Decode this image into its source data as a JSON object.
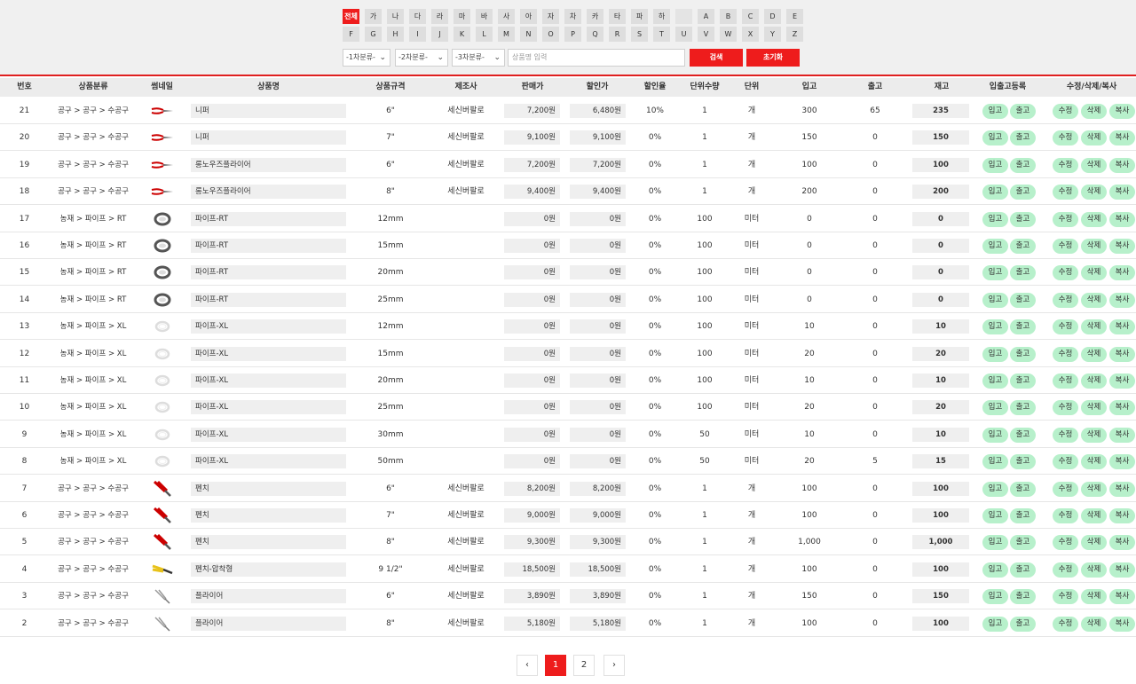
{
  "filter": {
    "letters_row1": [
      "전체",
      "가",
      "나",
      "다",
      "라",
      "마",
      "바",
      "사",
      "아",
      "자",
      "차",
      "카",
      "타",
      "파",
      "하",
      "",
      "A",
      "B",
      "C",
      "D",
      "E"
    ],
    "letters_row2": [
      "F",
      "G",
      "H",
      "I",
      "J",
      "K",
      "L",
      "M",
      "N",
      "O",
      "P",
      "Q",
      "R",
      "S",
      "T",
      "U",
      "V",
      "W",
      "X",
      "Y",
      "Z"
    ],
    "active_letter": "전체",
    "cat1": "-1차분류-",
    "cat2": "-2차분류-",
    "cat3": "-3차분류-",
    "search_placeholder": "상품명 입력",
    "search_label": "검색",
    "reset_label": "초기화"
  },
  "columns": [
    "번호",
    "상품분류",
    "썸네일",
    "상품명",
    "상품규격",
    "제조사",
    "판매가",
    "할인가",
    "할인율",
    "단위수량",
    "단위",
    "입고",
    "출고",
    "재고",
    "입출고등록",
    "수정/삭제/복사"
  ],
  "action_labels": {
    "in": "입고",
    "out": "출고",
    "edit": "수정",
    "delete": "삭제",
    "copy": "복사"
  },
  "accent_color": "#ee1c1c",
  "button_green": "#b7f0cb",
  "rows": [
    {
      "no": "21",
      "cat": "공구 > 공구 > 수공구",
      "thumb": "nipper-icon",
      "name": "니퍼",
      "spec": "6\"",
      "maker": "세신버팔로",
      "price": "7,200원",
      "sale": "6,480원",
      "rate": "10%",
      "unit_qty": "1",
      "unit": "개",
      "in_qty": "300",
      "out_qty": "65",
      "stock": "235"
    },
    {
      "no": "20",
      "cat": "공구 > 공구 > 수공구",
      "thumb": "nipper-icon",
      "name": "니퍼",
      "spec": "7\"",
      "maker": "세신버팔로",
      "price": "9,100원",
      "sale": "9,100원",
      "rate": "0%",
      "unit_qty": "1",
      "unit": "개",
      "in_qty": "150",
      "out_qty": "0",
      "stock": "150"
    },
    {
      "no": "19",
      "cat": "공구 > 공구 > 수공구",
      "thumb": "nipper-icon",
      "name": "롱노우즈플라이어",
      "spec": "6\"",
      "maker": "세신버팔로",
      "price": "7,200원",
      "sale": "7,200원",
      "rate": "0%",
      "unit_qty": "1",
      "unit": "개",
      "in_qty": "100",
      "out_qty": "0",
      "stock": "100"
    },
    {
      "no": "18",
      "cat": "공구 > 공구 > 수공구",
      "thumb": "nipper-icon",
      "name": "롱노우즈플라이어",
      "spec": "8\"",
      "maker": "세신버팔로",
      "price": "9,400원",
      "sale": "9,400원",
      "rate": "0%",
      "unit_qty": "1",
      "unit": "개",
      "in_qty": "200",
      "out_qty": "0",
      "stock": "200"
    },
    {
      "no": "17",
      "cat": "농재 > 파이프 > RT",
      "thumb": "pipe-rt-icon",
      "name": "파이프-RT",
      "spec": "12mm",
      "maker": "",
      "price": "0원",
      "sale": "0원",
      "rate": "0%",
      "unit_qty": "100",
      "unit": "미터",
      "in_qty": "0",
      "out_qty": "0",
      "stock": "0"
    },
    {
      "no": "16",
      "cat": "농재 > 파이프 > RT",
      "thumb": "pipe-rt-icon",
      "name": "파이프-RT",
      "spec": "15mm",
      "maker": "",
      "price": "0원",
      "sale": "0원",
      "rate": "0%",
      "unit_qty": "100",
      "unit": "미터",
      "in_qty": "0",
      "out_qty": "0",
      "stock": "0"
    },
    {
      "no": "15",
      "cat": "농재 > 파이프 > RT",
      "thumb": "pipe-rt-icon",
      "name": "파이프-RT",
      "spec": "20mm",
      "maker": "",
      "price": "0원",
      "sale": "0원",
      "rate": "0%",
      "unit_qty": "100",
      "unit": "미터",
      "in_qty": "0",
      "out_qty": "0",
      "stock": "0"
    },
    {
      "no": "14",
      "cat": "농재 > 파이프 > RT",
      "thumb": "pipe-rt-icon",
      "name": "파이프-RT",
      "spec": "25mm",
      "maker": "",
      "price": "0원",
      "sale": "0원",
      "rate": "0%",
      "unit_qty": "100",
      "unit": "미터",
      "in_qty": "0",
      "out_qty": "0",
      "stock": "0"
    },
    {
      "no": "13",
      "cat": "농재 > 파이프 > XL",
      "thumb": "pipe-xl-icon",
      "name": "파이프-XL",
      "spec": "12mm",
      "maker": "",
      "price": "0원",
      "sale": "0원",
      "rate": "0%",
      "unit_qty": "100",
      "unit": "미터",
      "in_qty": "10",
      "out_qty": "0",
      "stock": "10"
    },
    {
      "no": "12",
      "cat": "농재 > 파이프 > XL",
      "thumb": "pipe-xl-icon",
      "name": "파이프-XL",
      "spec": "15mm",
      "maker": "",
      "price": "0원",
      "sale": "0원",
      "rate": "0%",
      "unit_qty": "100",
      "unit": "미터",
      "in_qty": "20",
      "out_qty": "0",
      "stock": "20"
    },
    {
      "no": "11",
      "cat": "농재 > 파이프 > XL",
      "thumb": "pipe-xl-icon",
      "name": "파이프-XL",
      "spec": "20mm",
      "maker": "",
      "price": "0원",
      "sale": "0원",
      "rate": "0%",
      "unit_qty": "100",
      "unit": "미터",
      "in_qty": "10",
      "out_qty": "0",
      "stock": "10"
    },
    {
      "no": "10",
      "cat": "농재 > 파이프 > XL",
      "thumb": "pipe-xl-icon",
      "name": "파이프-XL",
      "spec": "25mm",
      "maker": "",
      "price": "0원",
      "sale": "0원",
      "rate": "0%",
      "unit_qty": "100",
      "unit": "미터",
      "in_qty": "20",
      "out_qty": "0",
      "stock": "20"
    },
    {
      "no": "9",
      "cat": "농재 > 파이프 > XL",
      "thumb": "pipe-xl-icon",
      "name": "파이프-XL",
      "spec": "30mm",
      "maker": "",
      "price": "0원",
      "sale": "0원",
      "rate": "0%",
      "unit_qty": "50",
      "unit": "미터",
      "in_qty": "10",
      "out_qty": "0",
      "stock": "10"
    },
    {
      "no": "8",
      "cat": "농재 > 파이프 > XL",
      "thumb": "pipe-xl-icon",
      "name": "파이프-XL",
      "spec": "50mm",
      "maker": "",
      "price": "0원",
      "sale": "0원",
      "rate": "0%",
      "unit_qty": "50",
      "unit": "미터",
      "in_qty": "20",
      "out_qty": "5",
      "stock": "15"
    },
    {
      "no": "7",
      "cat": "공구 > 공구 > 수공구",
      "thumb": "pliers-icon",
      "name": "펜치",
      "spec": "6\"",
      "maker": "세신버팔로",
      "price": "8,200원",
      "sale": "8,200원",
      "rate": "0%",
      "unit_qty": "1",
      "unit": "개",
      "in_qty": "100",
      "out_qty": "0",
      "stock": "100"
    },
    {
      "no": "6",
      "cat": "공구 > 공구 > 수공구",
      "thumb": "pliers-icon",
      "name": "펜치",
      "spec": "7\"",
      "maker": "세신버팔로",
      "price": "9,000원",
      "sale": "9,000원",
      "rate": "0%",
      "unit_qty": "1",
      "unit": "개",
      "in_qty": "100",
      "out_qty": "0",
      "stock": "100"
    },
    {
      "no": "5",
      "cat": "공구 > 공구 > 수공구",
      "thumb": "pliers-icon",
      "name": "펜치",
      "spec": "8\"",
      "maker": "세신버팔로",
      "price": "9,300원",
      "sale": "9,300원",
      "rate": "0%",
      "unit_qty": "1",
      "unit": "개",
      "in_qty": "1,000",
      "out_qty": "0",
      "stock": "1,000"
    },
    {
      "no": "4",
      "cat": "공구 > 공구 > 수공구",
      "thumb": "crimp-pliers-icon",
      "name": "펜치-압착형",
      "spec": "9 1/2\"",
      "maker": "세신버팔로",
      "price": "18,500원",
      "sale": "18,500원",
      "rate": "0%",
      "unit_qty": "1",
      "unit": "개",
      "in_qty": "100",
      "out_qty": "0",
      "stock": "100"
    },
    {
      "no": "3",
      "cat": "공구 > 공구 > 수공구",
      "thumb": "plain-pliers-icon",
      "name": "플라이어",
      "spec": "6\"",
      "maker": "세신버팔로",
      "price": "3,890원",
      "sale": "3,890원",
      "rate": "0%",
      "unit_qty": "1",
      "unit": "개",
      "in_qty": "150",
      "out_qty": "0",
      "stock": "150"
    },
    {
      "no": "2",
      "cat": "공구 > 공구 > 수공구",
      "thumb": "plain-pliers-icon",
      "name": "플라이어",
      "spec": "8\"",
      "maker": "세신버팔로",
      "price": "5,180원",
      "sale": "5,180원",
      "rate": "0%",
      "unit_qty": "1",
      "unit": "개",
      "in_qty": "100",
      "out_qty": "0",
      "stock": "100"
    }
  ],
  "pagination": {
    "prev": "‹",
    "pages": [
      "1",
      "2"
    ],
    "current": "1",
    "next": "›"
  }
}
